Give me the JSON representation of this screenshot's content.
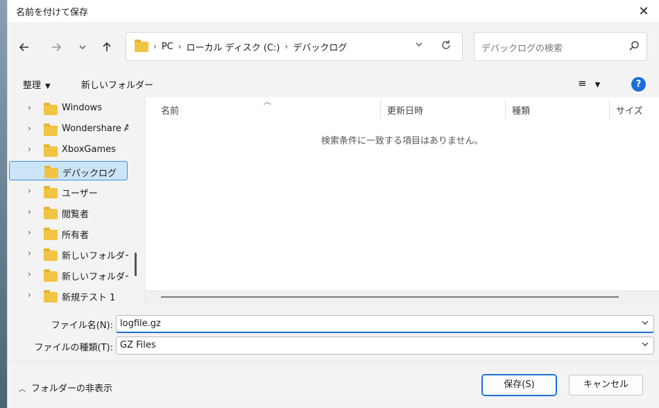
{
  "window": {
    "title": "名前を付けて保存",
    "close_icon": "✕"
  },
  "navigation": {
    "back_icon": "arrow-left-icon",
    "forward_icon": "arrow-right-icon",
    "recent_icon": "chevron-down-icon",
    "up_icon": "arrow-up-icon"
  },
  "address": {
    "breadcrumbs": [
      "PC",
      "ローカル ディスク (C:)",
      "デバックログ"
    ],
    "separator": "›"
  },
  "search": {
    "placeholder": "デバックログの検索"
  },
  "toolbar": {
    "organize_label": "整理",
    "new_folder_label": "新しいフォルダー"
  },
  "nav_pane": {
    "items": [
      {
        "label": "Windows",
        "expandable": true,
        "selected": false
      },
      {
        "label": "Wondershare A",
        "expandable": true,
        "selected": false
      },
      {
        "label": "XboxGames",
        "expandable": true,
        "selected": false
      },
      {
        "label": "デバックログ",
        "expandable": false,
        "selected": true
      },
      {
        "label": "ユーザー",
        "expandable": true,
        "selected": false
      },
      {
        "label": "閲覧者",
        "expandable": true,
        "selected": false
      },
      {
        "label": "所有者",
        "expandable": true,
        "selected": false
      },
      {
        "label": "新しいフォルダー",
        "expandable": true,
        "selected": false
      },
      {
        "label": "新しいフォルダー",
        "expandable": true,
        "selected": false
      },
      {
        "label": "新規テスト 1",
        "expandable": true,
        "selected": false
      }
    ]
  },
  "file_list": {
    "columns": [
      "名前",
      "更新日時",
      "種類",
      "サイズ"
    ],
    "empty_message": "検索条件に一致する項目はありません。"
  },
  "form": {
    "filename_label": "ファイル名(N):",
    "filename_value": "logfile.gz",
    "filetype_label": "ファイルの種類(T):",
    "filetype_value": "GZ Files"
  },
  "footer": {
    "hide_folders_label": "フォルダーの非表示",
    "save_label": "保存(S)",
    "cancel_label": "キャンセル"
  },
  "colors": {
    "accent": "#1d6fd8",
    "folder": "#f2c444",
    "selection_bg": "#cce4f7"
  }
}
